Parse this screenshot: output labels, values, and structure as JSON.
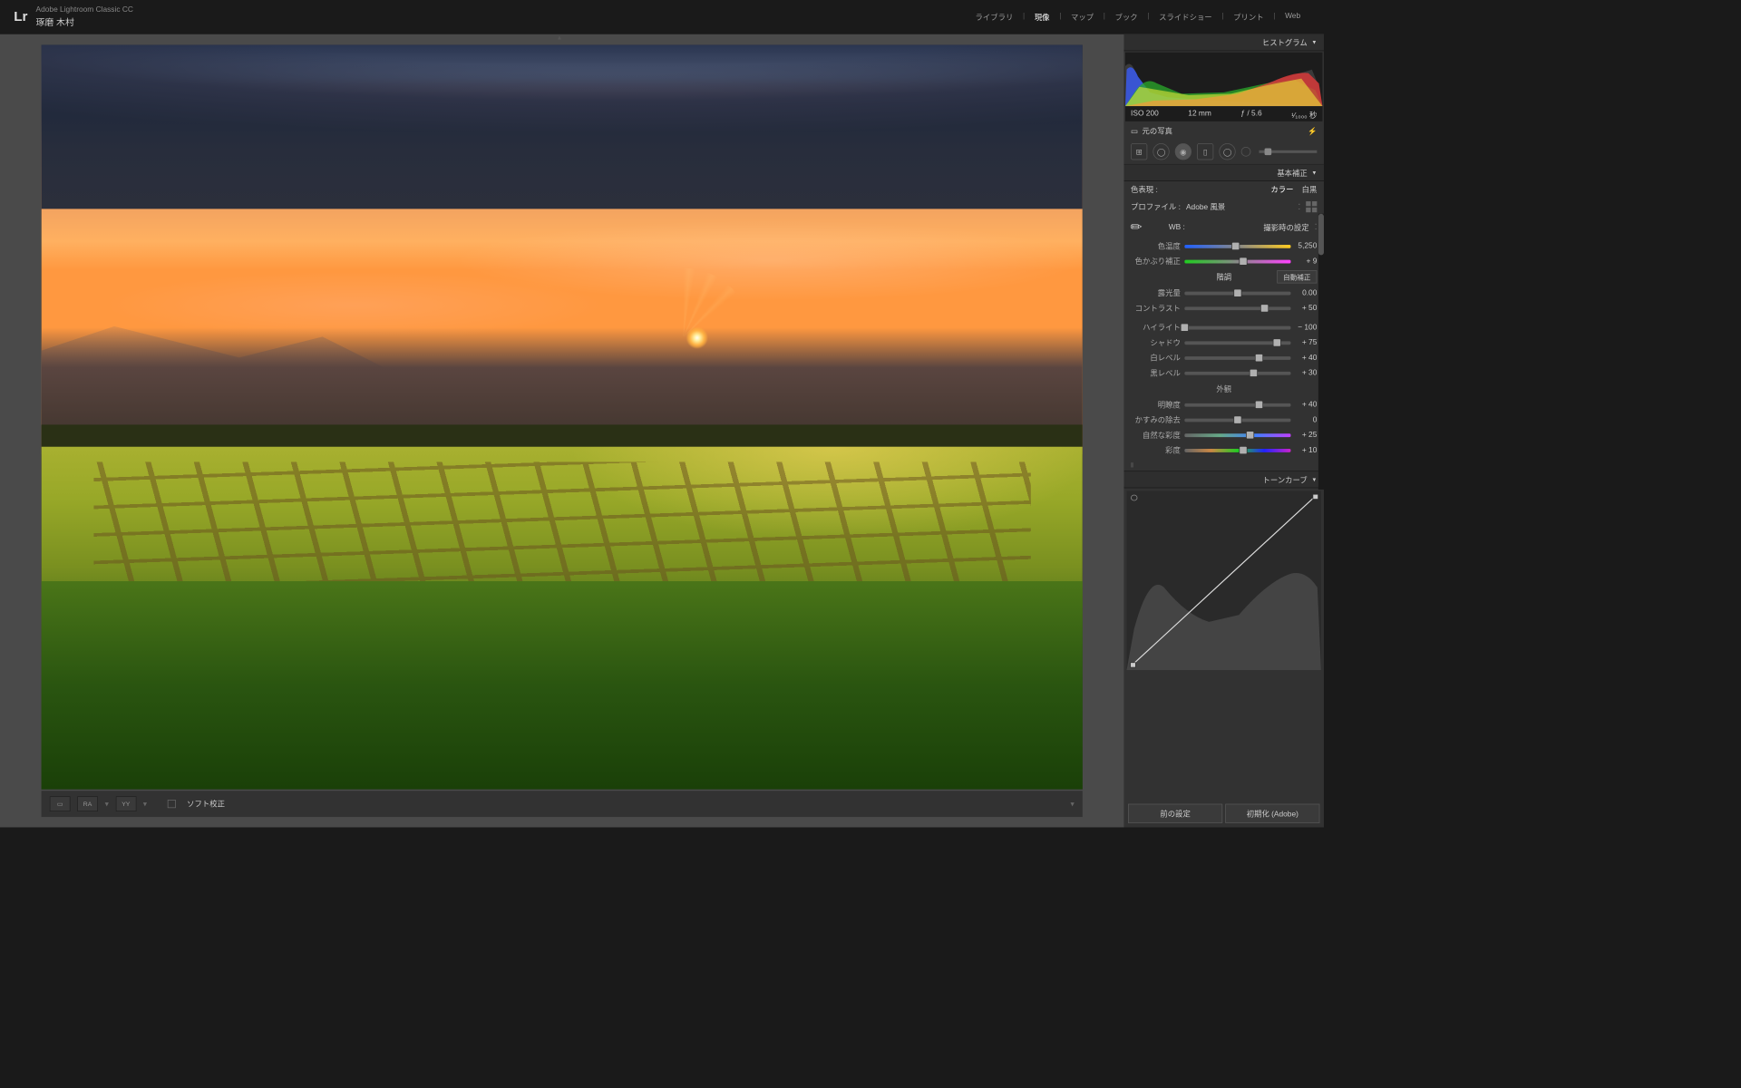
{
  "app": {
    "name": "Adobe Lightroom Classic CC",
    "user": "琢磨 木村",
    "logo": "Lr"
  },
  "nav": {
    "items": [
      "ライブラリ",
      "現像",
      "マップ",
      "ブック",
      "スライドショー",
      "プリント",
      "Web"
    ],
    "active": 1
  },
  "histogram": {
    "title": "ヒストグラム",
    "iso": "ISO 200",
    "focal": "12 mm",
    "aperture": "ƒ / 5.6",
    "shutter": "¹⁄₁₀₀₀ 秒",
    "original": "元の写真",
    "flash": "⚡"
  },
  "basic": {
    "title": "基本補正",
    "treatment": {
      "label": "色表現 :",
      "color": "カラー",
      "bw": "白黒"
    },
    "profile": {
      "label": "プロファイル :",
      "value": "Adobe 風景"
    },
    "wb": {
      "label": "WB :",
      "preset": "撮影時の設定"
    },
    "temp": {
      "label": "色温度",
      "value": "5,250",
      "pos": 48
    },
    "tint": {
      "label": "色かぶり補正",
      "value": "+ 9",
      "pos": 55
    },
    "tone_hdr": "階調",
    "auto": "自動補正",
    "exposure": {
      "label": "露光量",
      "value": "0.00",
      "pos": 50
    },
    "contrast": {
      "label": "コントラスト",
      "value": "+ 50",
      "pos": 75
    },
    "highlights": {
      "label": "ハイライト",
      "value": "− 100",
      "pos": 0
    },
    "shadows": {
      "label": "シャドウ",
      "value": "+ 75",
      "pos": 87
    },
    "whites": {
      "label": "白レベル",
      "value": "+ 40",
      "pos": 70
    },
    "blacks": {
      "label": "黒レベル",
      "value": "+ 30",
      "pos": 65
    },
    "presence_hdr": "外観",
    "clarity": {
      "label": "明瞭度",
      "value": "+ 40",
      "pos": 70
    },
    "dehaze": {
      "label": "かすみの除去",
      "value": "0",
      "pos": 50
    },
    "vibrance": {
      "label": "自然な彩度",
      "value": "+ 25",
      "pos": 62
    },
    "saturation": {
      "label": "彩度",
      "value": "+ 10",
      "pos": 55
    }
  },
  "tonecurve": {
    "title": "トーンカーブ"
  },
  "footer": {
    "soft": "ソフト校正",
    "prev": "前の設定",
    "reset": "初期化 (Adobe)",
    "ra": "RA",
    "yy": "YY"
  }
}
